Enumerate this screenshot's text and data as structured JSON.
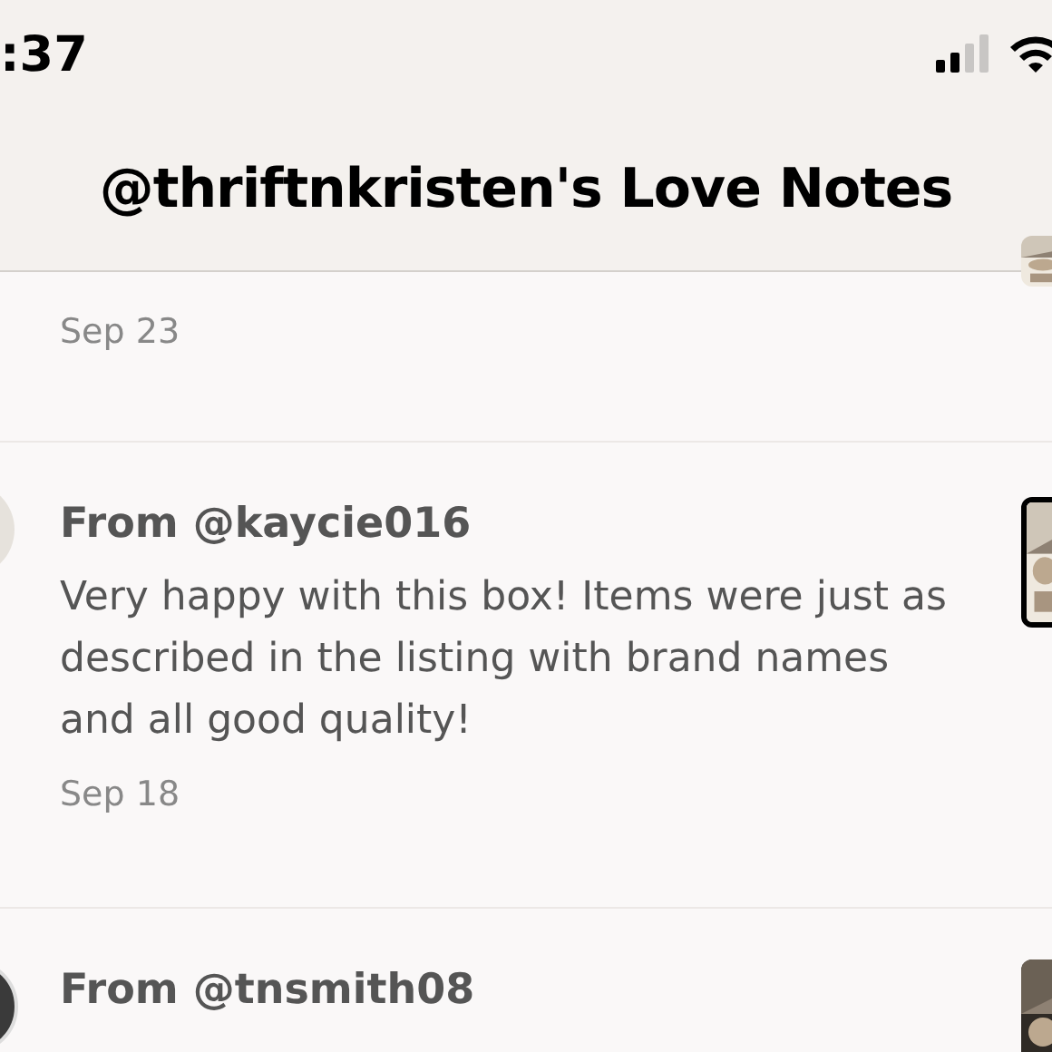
{
  "status_bar": {
    "time": ":37"
  },
  "header": {
    "title": "@thriftnkristen's Love Notes"
  },
  "notes": [
    {
      "date": "Sep 23",
      "avatar": false
    },
    {
      "from": "From @kaycie016",
      "text": "Very happy with this box! Items were just as described in the listing with brand names and all good quality!",
      "date": "Sep 18",
      "avatar": true
    },
    {
      "from": "From @tnsmith08",
      "avatar": true
    }
  ]
}
